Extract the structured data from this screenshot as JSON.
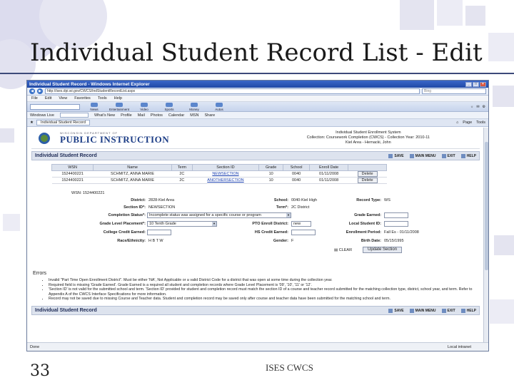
{
  "slide": {
    "title": "Individual Student Record List - Edit",
    "number": "33",
    "footer": "ISES CWCS"
  },
  "browser": {
    "window_title": "Individual Student Record - Windows Internet Explorer",
    "address": "http://ises.dpi.wi.gov/CWCS/IndStudentRecordList.aspx",
    "search_engine": "Bing",
    "menu": [
      "File",
      "Edit",
      "View",
      "Favorites",
      "Tools",
      "Help"
    ],
    "msn_buttons": [
      "News",
      "Entertainment",
      "Video",
      "Sports",
      "Money",
      "Autos"
    ],
    "links": [
      "Windows Live",
      "Bing",
      "What's New",
      "Profile",
      "Mail",
      "Photos",
      "Calendar",
      "MSN",
      "Share"
    ],
    "tab_label": "Individual Student Record",
    "tab_tools": [
      "Page",
      "Tools"
    ],
    "status_text": "Done",
    "status_zone": "Local intranet"
  },
  "header": {
    "dept": "WISCONSIN DEPARTMENT OF",
    "logo_text": "PUBLIC INSTRUCTION",
    "system_line1": "Individual Student Enrollment System",
    "system_line2": "Collection: Coursework Completion (CWCS) - Collection Year: 2010-11",
    "system_line3": "Kiel Area - Hernacki, John"
  },
  "section": {
    "title": "Individual Student Record",
    "actions": [
      "SAVE",
      "MAIN MENU",
      "EXIT",
      "HELP"
    ]
  },
  "students_table": {
    "columns": [
      "WSN",
      "Name",
      "Term",
      "Section ID",
      "Grade",
      "School",
      "Enroll Date",
      ""
    ],
    "rows": [
      {
        "wsn": "1524400221",
        "name": "SCHMITZ, ANNA MARIE",
        "term": "2C",
        "section": "NEWSECTION",
        "grade": "10",
        "school": "0040",
        "enroll": "01/11/2008",
        "action": "Delete"
      },
      {
        "wsn": "1524400221",
        "name": "SCHMITZ, ANNA MARIE",
        "term": "2C",
        "section": "ANOTHERSECTION",
        "grade": "10",
        "school": "0040",
        "enroll": "01/11/2008",
        "action": "Delete"
      }
    ]
  },
  "detail": {
    "wsn_label": "WSN:",
    "wsn_value": "1524400221",
    "district_label": "District:",
    "district_value": "2828-Kiel Area",
    "school_label": "School:",
    "school_value": "0040-Kiel High",
    "record_type_label": "Record Type:",
    "record_type_value": "WS",
    "section_label": "Section ID*:",
    "section_value": "NEWSECTION",
    "term_label": "Term*:",
    "term_value": "2C District",
    "completion_label": "Completion Status*:",
    "completion_value": "Incomplete status was assigned for a specific course or program",
    "grade_earned_label": "Grade Earned:",
    "grade_level_label": "Grade Level Placement*:",
    "grade_level_value": "10 Tenth Grade",
    "pto_label": "PTO Enroll District:",
    "pto_value": "new",
    "local_student_label": "Local Student ID:",
    "college_label": "College Credit Earned:",
    "hs_credit_label": "HS Credit Earned:",
    "enrollment_label": "Enrollment Period:",
    "enrollment_value": "Fall Es - 01/11/2008",
    "race_label": "Race/Ethnicity:",
    "race_value": "H B T W",
    "gender_label": "Gender:",
    "gender_value": "F",
    "birth_label": "Birth Date:",
    "birth_value": "05/15/1995",
    "clear_label": "CLEAR",
    "update_label": "Update Section"
  },
  "errors": {
    "heading": "Errors",
    "items": [
      "Invalid \"Part Time Open Enrollment District\". Must be either 'NA', Not Applicable or a valid District Code for a district that was open at some time during the collection year.",
      "Required field is missing 'Grade Earned'. Grade Earned is a required all student and completion records where Grade Level Placement is '09', '10', '11' or '12'.",
      "'Section ID' is not valid for the submitted school and term. 'Section ID' provided for student and completion record must match the section ID of a course and teacher record submitted for the matching collection type, district, school year, and term. Refer to Appendix A of the CWCS Interface Specifications for more information.",
      "Record may not be saved due to missing Course and Teacher data. Student and completion record may be saved only after course and teacher data have been submitted for the matching school and term."
    ]
  },
  "colors": {
    "title_rule": "#3d4a7a",
    "ie_titlebar": "#2a56b8",
    "section_bar": "#dde3ee",
    "link": "#1a3fb0"
  }
}
